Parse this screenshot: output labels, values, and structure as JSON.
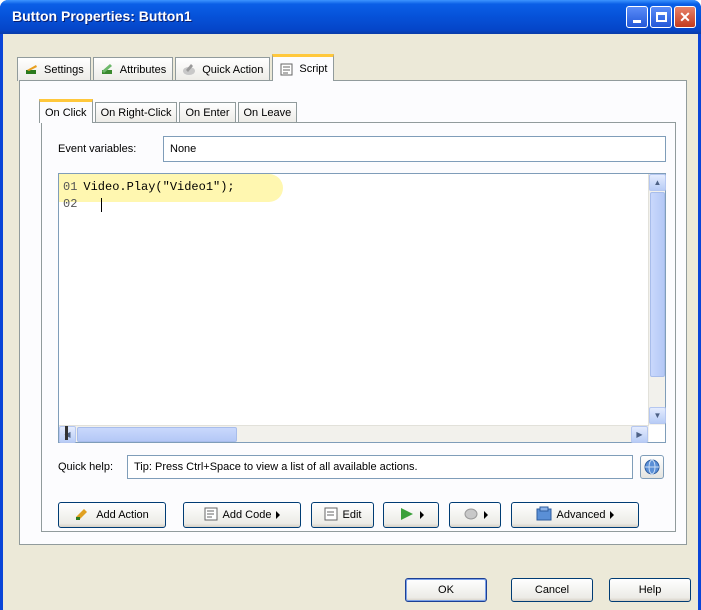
{
  "window": {
    "title": "Button Properties: Button1"
  },
  "outer_tabs": [
    {
      "label": "Settings",
      "icon": "settings-icon",
      "active": false
    },
    {
      "label": "Attributes",
      "icon": "attributes-icon",
      "active": false
    },
    {
      "label": "Quick Action",
      "icon": "quick-action-icon",
      "active": false
    },
    {
      "label": "Script",
      "icon": "script-icon",
      "active": true
    }
  ],
  "inner_tabs": [
    {
      "label": "On Click",
      "active": true
    },
    {
      "label": "On Right-Click",
      "active": false
    },
    {
      "label": "On Enter",
      "active": false
    },
    {
      "label": "On Leave",
      "active": false
    }
  ],
  "event_variables": {
    "label": "Event variables:",
    "value": "None"
  },
  "editor": {
    "lines": [
      {
        "num": "01",
        "code": "Video.Play(\"Video1\");"
      },
      {
        "num": "02",
        "code": ""
      }
    ]
  },
  "quick_help": {
    "label": "Quick help:",
    "text": "Tip: Press Ctrl+Space to view a list of all available actions."
  },
  "action_buttons": {
    "add_action": "Add Action",
    "add_code": "Add Code",
    "edit": "Edit",
    "advanced": "Advanced"
  },
  "dialog_buttons": {
    "ok": "OK",
    "cancel": "Cancel",
    "help": "Help"
  },
  "colors": {
    "titlebar": "#0651D8",
    "tab_highlight": "#FFC83C",
    "code_highlight": "#FFF7B0",
    "dialog_bg": "#ECE9D8"
  }
}
